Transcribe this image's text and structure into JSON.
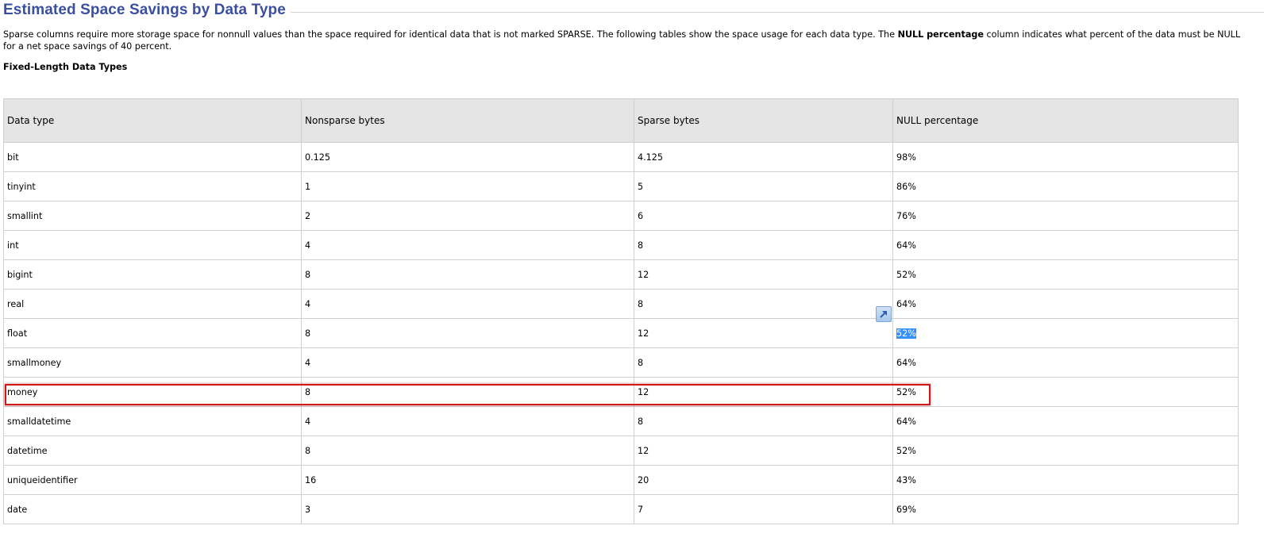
{
  "header": {
    "title": "Estimated Space Savings by Data Type"
  },
  "intro": {
    "part1": "Sparse columns require more storage space for nonnull values than the space required for identical data that is not marked SPARSE. The following tables show the space usage for each data type. The ",
    "bold": "NULL percentage",
    "part2": " column indicates what percent of the data must be NULL for a net space savings of 40 percent."
  },
  "subheading": "Fixed-Length Data Types",
  "table": {
    "columns": [
      "Data type",
      "Nonsparse bytes",
      "Sparse bytes",
      "NULL percentage"
    ],
    "rows": [
      [
        "bit",
        "0.125",
        "4.125",
        "98%"
      ],
      [
        "tinyint",
        "1",
        "5",
        "86%"
      ],
      [
        "smallint",
        "2",
        "6",
        "76%"
      ],
      [
        "int",
        "4",
        "8",
        "64%"
      ],
      [
        "bigint",
        "8",
        "12",
        "52%"
      ],
      [
        "real",
        "4",
        "8",
        "64%"
      ],
      [
        "float",
        "8",
        "12",
        "52%"
      ],
      [
        "smallmoney",
        "4",
        "8",
        "64%"
      ],
      [
        "money",
        "8",
        "12",
        "52%"
      ],
      [
        "smalldatetime",
        "4",
        "8",
        "64%"
      ],
      [
        "datetime",
        "8",
        "12",
        "52%"
      ],
      [
        "uniqueidentifier",
        "16",
        "20",
        "43%"
      ],
      [
        "date",
        "3",
        "7",
        "69%"
      ]
    ],
    "selected_cell": {
      "row": 6,
      "col": 3
    },
    "highlighted_row": 8
  },
  "overlay": {
    "icon": "expand-arrow-icon"
  },
  "colors": {
    "title": "#3b4fa0",
    "header_bg": "#e5e5e5",
    "highlight_border": "#d01818",
    "selection": "#3390ff"
  }
}
